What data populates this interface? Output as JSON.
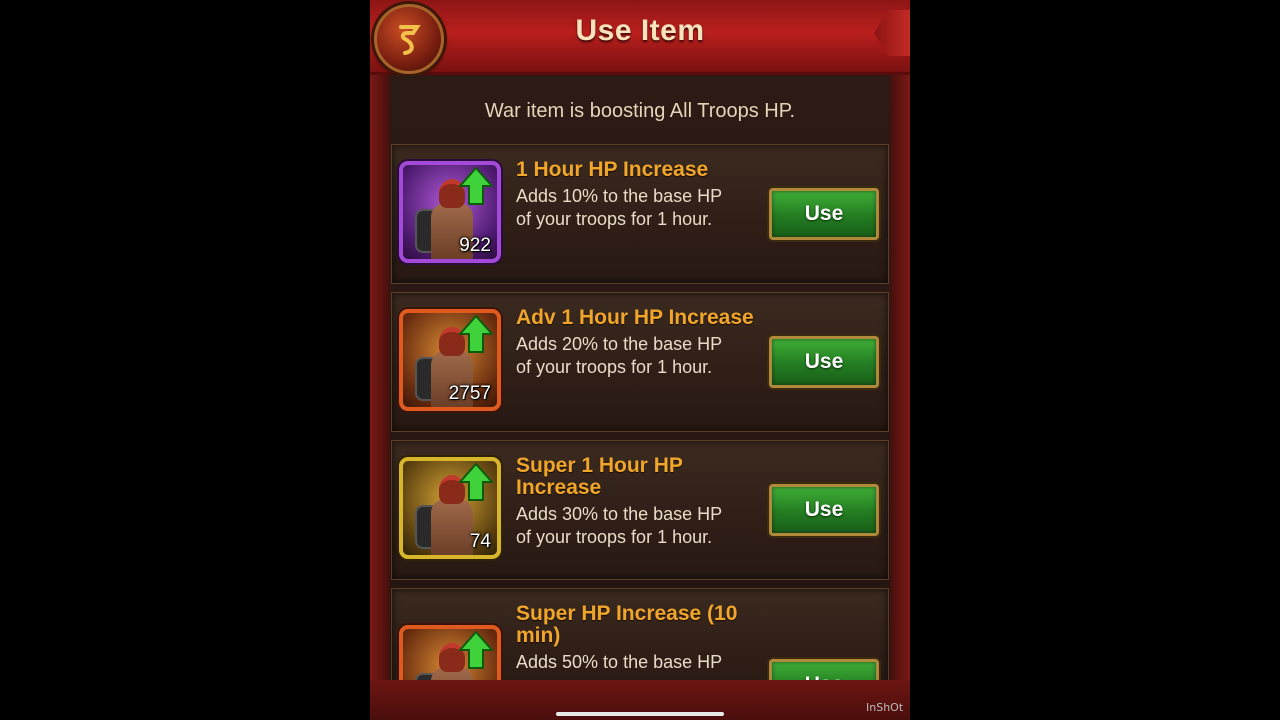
{
  "header": {
    "title": "Use Item",
    "back_icon": "rotate-back-icon",
    "close_icon": "close-notch-icon"
  },
  "status_text": "War item is boosting All Troops HP.",
  "items": [
    {
      "title": "1 Hour HP Increase",
      "description_line1": "Adds 10% to the base HP",
      "description_line2": "of your troops for 1 hour.",
      "count": "922",
      "rarity": "purple",
      "button_label": "Use"
    },
    {
      "title": "Adv 1 Hour HP Increase",
      "description_line1": "Adds 20% to the base HP",
      "description_line2": "of your troops for 1 hour.",
      "count": "2757",
      "rarity": "orange",
      "button_label": "Use"
    },
    {
      "title": "Super 1 Hour HP Increase",
      "description_line1": "Adds 30% to the base HP",
      "description_line2": "of your troops for 1 hour.",
      "count": "74",
      "rarity": "yellow",
      "button_label": "Use"
    },
    {
      "title": "Super HP Increase (10 min)",
      "description_line1": "Adds 50% to the base HP",
      "rarity": "orange",
      "button_label": "Use"
    }
  ],
  "watermark": "InShOt",
  "colors": {
    "header_red": "#b91f1d",
    "title_gold": "#f0a62a",
    "button_green": "#237c22"
  }
}
